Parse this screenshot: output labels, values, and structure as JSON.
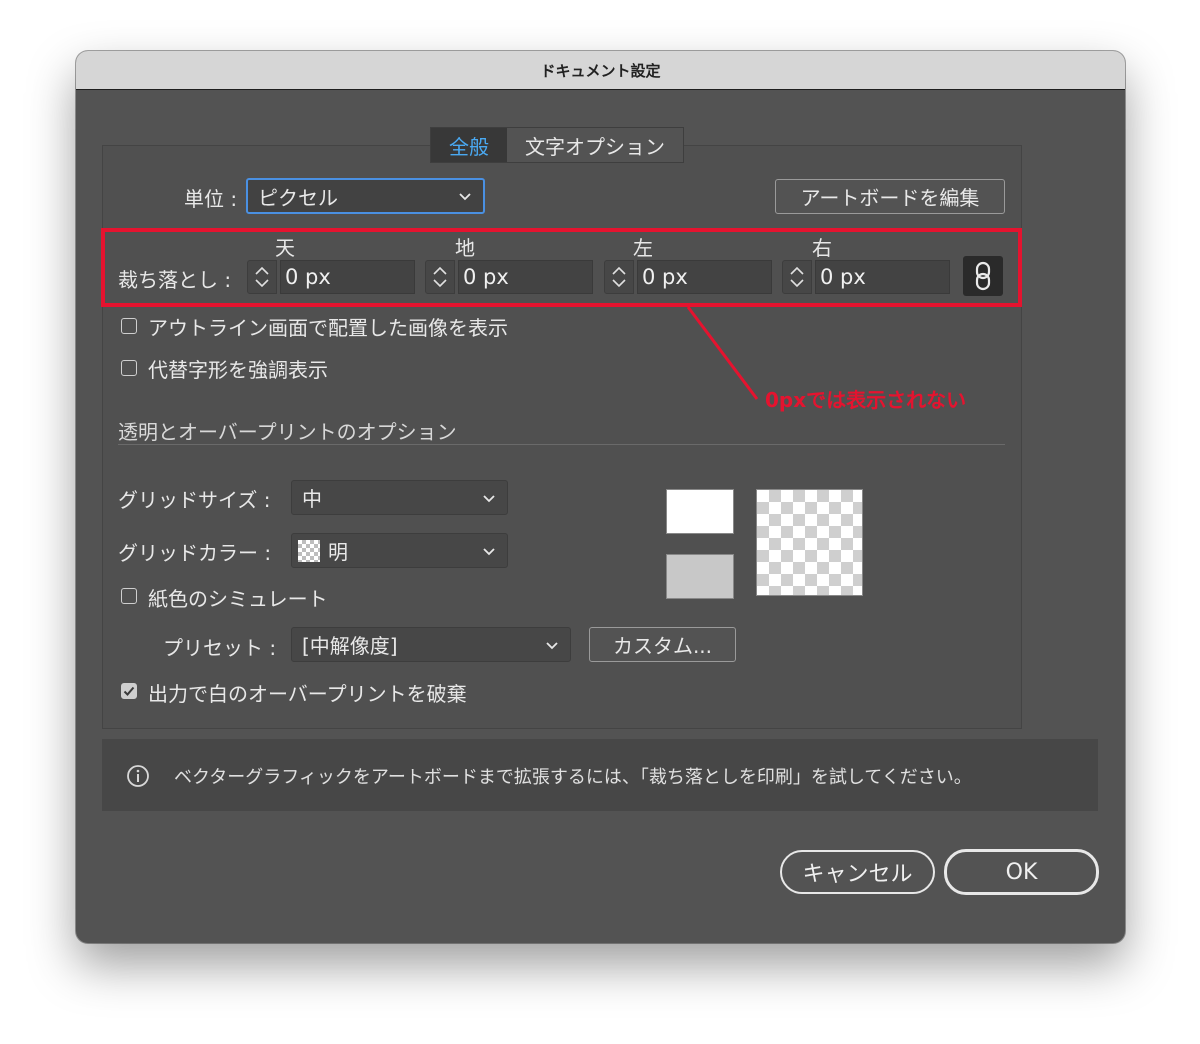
{
  "window": {
    "title": "ドキュメント設定"
  },
  "tabs": [
    {
      "label": "全般",
      "active": true
    },
    {
      "label": "文字オプション",
      "active": false
    }
  ],
  "unit": {
    "label": "単位 :",
    "value": "ピクセル"
  },
  "edit_artboards_label": "アートボードを編集",
  "bleed": {
    "label": "裁ち落とし :",
    "fields": [
      {
        "name": "天",
        "value": "0 px"
      },
      {
        "name": "地",
        "value": "0 px"
      },
      {
        "name": "左",
        "value": "0 px"
      },
      {
        "name": "右",
        "value": "0 px"
      }
    ],
    "link_icon": "link-icon"
  },
  "checkboxes": {
    "outline_images": {
      "label": "アウトライン画面で配置した画像を表示",
      "checked": false
    },
    "alt_glyphs": {
      "label": "代替字形を強調表示",
      "checked": false
    },
    "paper_sim": {
      "label": "紙色のシミュレート",
      "checked": false
    },
    "discard_white_overprint": {
      "label": "出力で白のオーバープリントを破棄",
      "checked": true
    }
  },
  "annotation": {
    "text": "0pxでは表示されない",
    "color": "#e5132f"
  },
  "transparency": {
    "section_title": "透明とオーバープリントのオプション",
    "grid_size": {
      "label": "グリッドサイズ :",
      "value": "中"
    },
    "grid_color": {
      "label": "グリッドカラー :",
      "value": "明"
    },
    "preset": {
      "label": "プリセット :",
      "value": "[中解像度]"
    },
    "custom_label": "カスタム..."
  },
  "info": {
    "text": "ベクターグラフィックをアートボードまで拡張するには、「裁ち落としを印刷」を試してください。",
    "icon": "info-icon"
  },
  "footer": {
    "cancel_label": "キャンセル",
    "ok_label": "OK"
  },
  "colors": {
    "accent": "#4aa9f2",
    "dialog_bg": "#535353",
    "highlight": "#e5132f"
  }
}
